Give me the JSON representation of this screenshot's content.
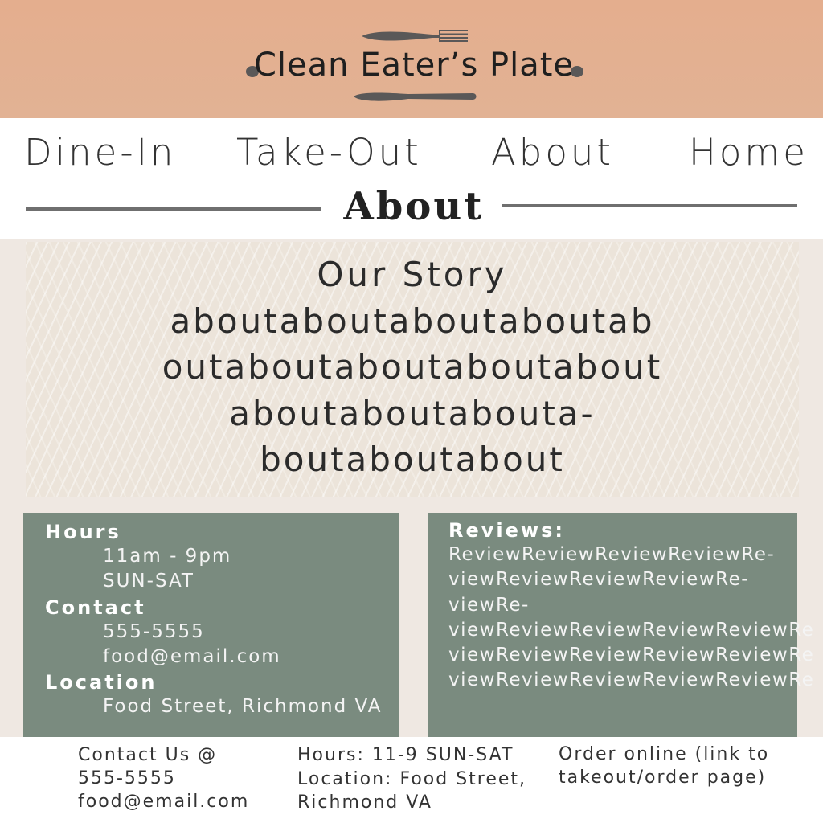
{
  "brand": {
    "name": "Clean Eater’s Plate"
  },
  "nav": {
    "items": [
      "Dine-In",
      "Take-Out",
      "About",
      "Home"
    ]
  },
  "page": {
    "title": "About"
  },
  "story": {
    "title": "Our Story",
    "lines": [
      "aboutaboutaboutaboutab",
      "outaboutaboutaboutabout",
      "aboutaboutabouta-",
      "boutaboutabout"
    ]
  },
  "info": {
    "hours_label": "Hours",
    "hours_time": "11am - 9pm",
    "hours_days": "SUN-SAT",
    "contact_label": "Contact",
    "contact_phone": "555-5555",
    "contact_email": "food@email.com",
    "location_label": "Location",
    "location_value": "Food Street, Richmond VA"
  },
  "reviews": {
    "label": "Reviews:",
    "lines": [
      "ReviewReviewReviewReviewRe-",
      "viewReviewReviewReviewRe-",
      "viewRe-",
      "viewReviewReviewReviewReviewRe",
      "viewReviewReviewReviewReviewRe",
      "viewReviewReviewReviewReviewRe"
    ]
  },
  "footer": {
    "contact_line1": "Contact Us @",
    "contact_phone": "555-5555",
    "contact_email": "food@email.com",
    "hours_line": "Hours: 11-9 SUN-SAT",
    "location_line1": "Location: Food Street,",
    "location_line2": "Richmond VA",
    "order_line1": "Order online (link to",
    "order_line2": "takeout/order page)"
  },
  "colors": {
    "header_bg": "#e4ae8e",
    "card_bg": "#7a8b7f",
    "rule": "#6f6f6f"
  }
}
